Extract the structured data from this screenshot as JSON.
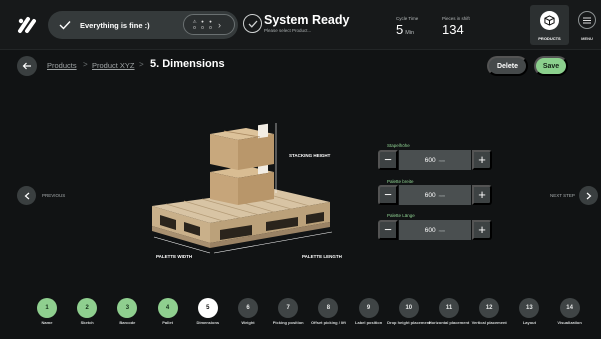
{
  "topbar": {
    "status_message": "Everything is fine :)",
    "counters": {
      "symbols": [
        "⚠",
        "●",
        "●"
      ],
      "values": [
        "0",
        "0",
        "0"
      ]
    },
    "ready_title": "System Ready",
    "ready_subtitle": "Please select Product...",
    "cycle_time": {
      "label": "Cycle Time",
      "value": "5",
      "unit": "Min"
    },
    "pieces_in_shift": {
      "label": "Pieces in shift",
      "value": "134"
    },
    "products_label": "PRODUCTS",
    "menu_label": "MENU"
  },
  "header": {
    "breadcrumbs": [
      "Products",
      "Product XYZ"
    ],
    "separator": ">",
    "title": "5. Dimensions",
    "delete_label": "Delete",
    "save_label": "Save"
  },
  "nav": {
    "previous_label": "PREVIOUS",
    "next_label": "NEXT STEP"
  },
  "illustration": {
    "stacking_height_label": "STACKING HEIGHT",
    "palette_width_label": "PALETTE WIDTH",
    "palette_length_label": "PALETTE LENGTH"
  },
  "fields": [
    {
      "label": "Stapelhöhe",
      "value": "600",
      "unit": "mm"
    },
    {
      "label": "Palette breite",
      "value": "600",
      "unit": "mm"
    },
    {
      "label": "Palette Länge",
      "value": "600",
      "unit": "mm"
    }
  ],
  "steps": [
    {
      "number": "1",
      "label": "Name",
      "state": "done"
    },
    {
      "number": "2",
      "label": "Sketch",
      "state": "done"
    },
    {
      "number": "3",
      "label": "Barcode",
      "state": "done"
    },
    {
      "number": "4",
      "label": "Pallet",
      "state": "done"
    },
    {
      "number": "5",
      "label": "Dimensions",
      "state": "active"
    },
    {
      "number": "6",
      "label": "Weight",
      "state": "todo"
    },
    {
      "number": "7",
      "label": "Picking position",
      "state": "todo"
    },
    {
      "number": "8",
      "label": "Offset picking / lift",
      "state": "todo"
    },
    {
      "number": "9",
      "label": "Label position",
      "state": "todo"
    },
    {
      "number": "10",
      "label": "Drop height placement",
      "state": "todo"
    },
    {
      "number": "11",
      "label": "Horizontal placement",
      "state": "todo"
    },
    {
      "number": "12",
      "label": "Vertical placement",
      "state": "todo"
    },
    {
      "number": "13",
      "label": "Layout",
      "state": "todo"
    },
    {
      "number": "14",
      "label": "Visualization",
      "state": "todo"
    }
  ],
  "colors": {
    "background": "#111314",
    "accent_green": "#8bd08d",
    "pill": "#353a3b"
  }
}
